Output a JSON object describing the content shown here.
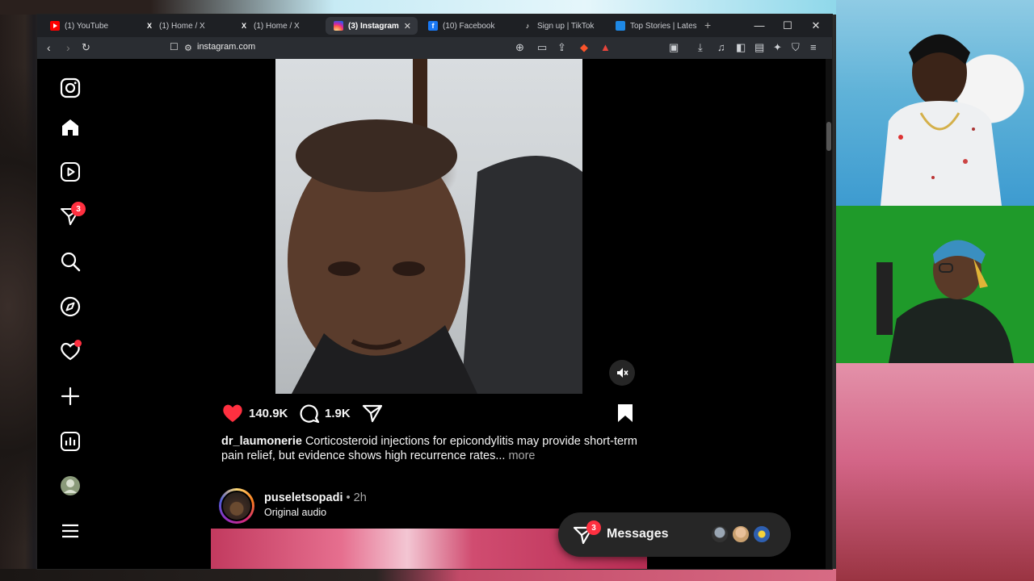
{
  "browser": {
    "tabs": [
      {
        "label": "(1) YouTube",
        "favicon": "youtube-icon",
        "active": false
      },
      {
        "label": "(1) Home / X",
        "favicon": "x-icon",
        "active": false
      },
      {
        "label": "(1) Home / X",
        "favicon": "x-icon",
        "active": false
      },
      {
        "label": "(3) Instagram",
        "favicon": "instagram-icon",
        "active": true
      },
      {
        "label": "(10) Facebook",
        "favicon": "facebook-icon",
        "active": false
      },
      {
        "label": "Sign up | TikTok",
        "favicon": "tiktok-icon",
        "active": false
      },
      {
        "label": "Top Stories | Lates",
        "favicon": "news-icon",
        "active": false
      }
    ],
    "url": "instagram.com"
  },
  "instagram": {
    "nav_badges": {
      "messages": "3"
    },
    "post": {
      "likes": "140.9K",
      "comments": "1.9K",
      "username": "dr_laumonerie",
      "caption": "Corticosteroid injections for epicondylitis may provide short-term pain relief, but evidence shows high recurrence rates...",
      "more": "more"
    },
    "next_post": {
      "username": "puseletsopadi",
      "time": " • 2h",
      "audio": "Original audio"
    },
    "messages_bar": {
      "label": "Messages",
      "badge": "3"
    }
  },
  "colors": {
    "like_red": "#ff3040",
    "badge_red": "#ff3040",
    "ig_bg": "#000000",
    "browser_chrome": "#2a2d32"
  }
}
